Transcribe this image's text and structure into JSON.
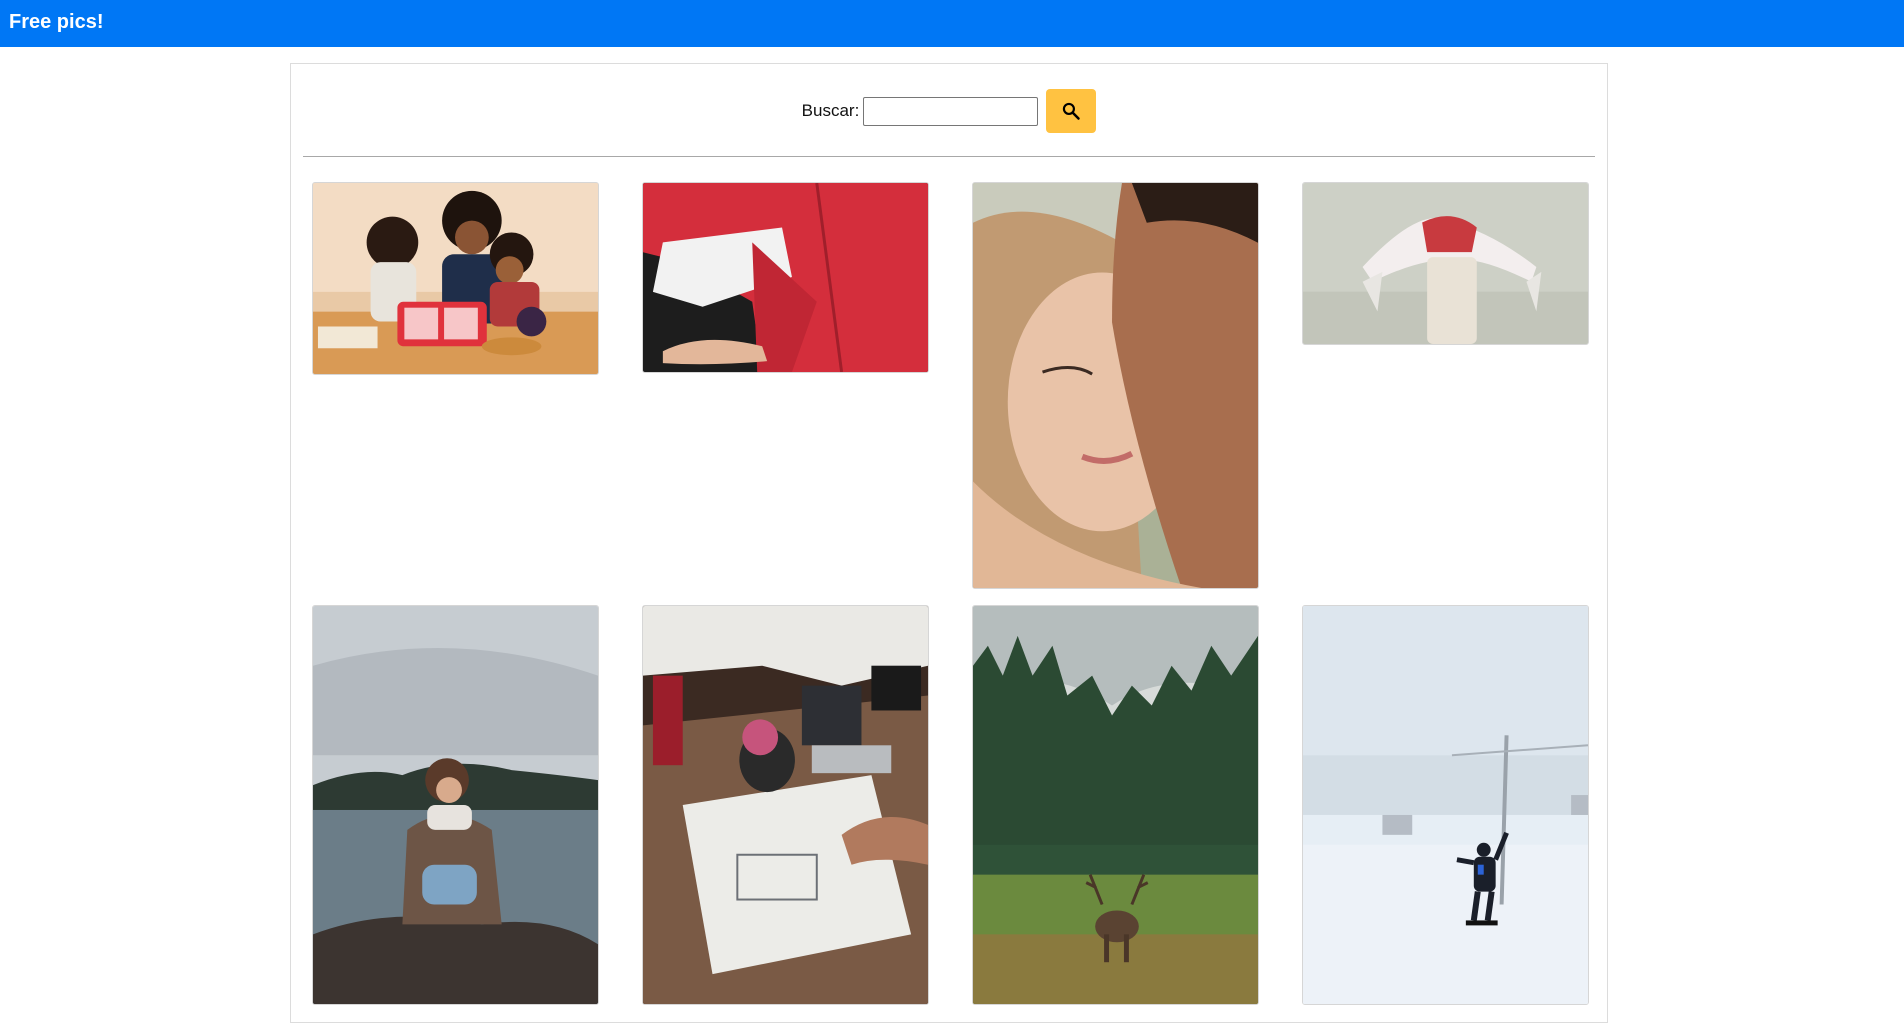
{
  "navbar": {
    "brand": "Free pics!",
    "color": "#0077f5"
  },
  "search": {
    "label": "Buscar:",
    "placeholder": "",
    "value": "",
    "button_icon": "search-icon",
    "button_color": "#ffc241"
  },
  "gallery": {
    "photos": [
      {
        "name": "family-table-photo"
      },
      {
        "name": "red-jacket-photo"
      },
      {
        "name": "couple-kiss-photo"
      },
      {
        "name": "scarf-woman-photo"
      },
      {
        "name": "lake-woman-photo"
      },
      {
        "name": "desk-drawing-photo"
      },
      {
        "name": "deer-forest-photo"
      },
      {
        "name": "snowboarder-photo"
      }
    ]
  }
}
